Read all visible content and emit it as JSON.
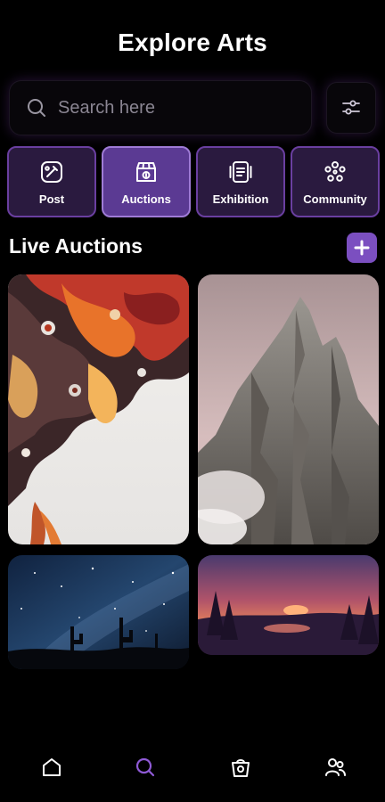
{
  "header": {
    "title": "Explore Arts"
  },
  "search": {
    "placeholder": "Search here"
  },
  "categories": [
    {
      "label": "Post",
      "icon": "post-icon"
    },
    {
      "label": "Auctions",
      "icon": "auction-store-icon",
      "active": true
    },
    {
      "label": "Exhibition",
      "icon": "exhibition-icon"
    },
    {
      "label": "Community",
      "icon": "community-icon"
    }
  ],
  "live_auctions": {
    "title": "Live Auctions",
    "items": [
      {
        "art": "fluid-abstract-painting"
      },
      {
        "art": "rocky-mountain-peak"
      },
      {
        "art": "starry-desert-night"
      },
      {
        "art": "sunset-forest-lake"
      }
    ]
  },
  "nav": {
    "items": [
      "home-icon",
      "explore-search-icon",
      "auction-bag-icon",
      "profile-users-icon"
    ],
    "active": "explore-search-icon"
  },
  "colors": {
    "accent": "#7b4fc0",
    "category_bg": "#2a1a3f",
    "category_active_bg": "#5b3a93",
    "background": "#000000"
  }
}
